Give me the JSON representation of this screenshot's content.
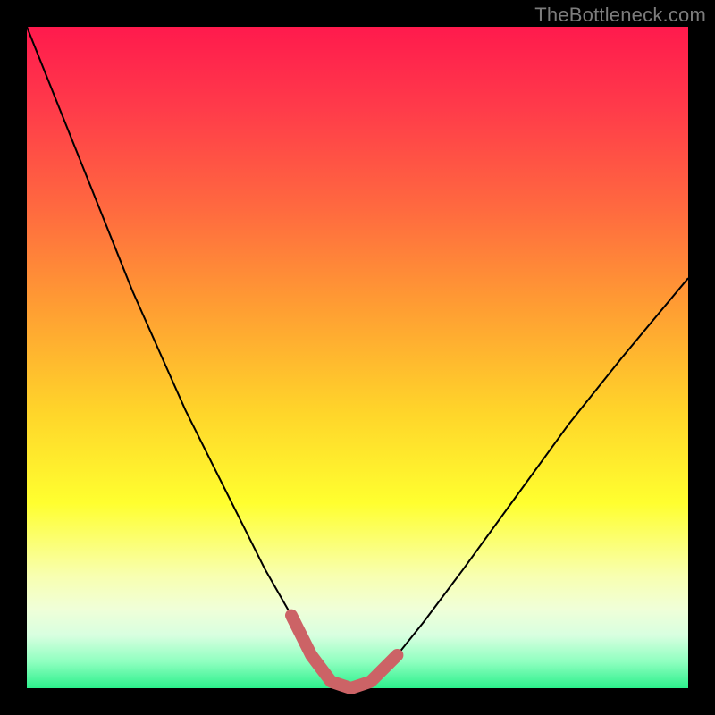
{
  "watermark": "TheBottleneck.com",
  "chart_data": {
    "type": "line",
    "title": "",
    "xlabel": "",
    "ylabel": "",
    "xlim": [
      0,
      100
    ],
    "ylim": [
      0,
      100
    ],
    "grid": false,
    "legend": false,
    "series": [
      {
        "name": "bottleneck-curve",
        "x": [
          0,
          4,
          8,
          12,
          16,
          20,
          24,
          28,
          32,
          36,
          40,
          43,
          46,
          49,
          52,
          56,
          60,
          66,
          74,
          82,
          90,
          100
        ],
        "y": [
          100,
          90,
          80,
          70,
          60,
          51,
          42,
          34,
          26,
          18,
          11,
          5,
          1,
          0,
          1,
          5,
          10,
          18,
          29,
          40,
          50,
          62
        ]
      },
      {
        "name": "optimal-zone",
        "x": [
          40,
          43,
          46,
          49,
          52,
          56
        ],
        "y": [
          11,
          5,
          1,
          0,
          1,
          5
        ]
      }
    ],
    "annotations": [
      {
        "text": "TheBottleneck.com",
        "position": "top-right"
      }
    ],
    "colors": {
      "curve": "#000000",
      "optimal_zone": "#cc6366",
      "gradient_top": "#ff1a4d",
      "gradient_mid": "#ffff2f",
      "gradient_bottom": "#2cf08c"
    }
  }
}
